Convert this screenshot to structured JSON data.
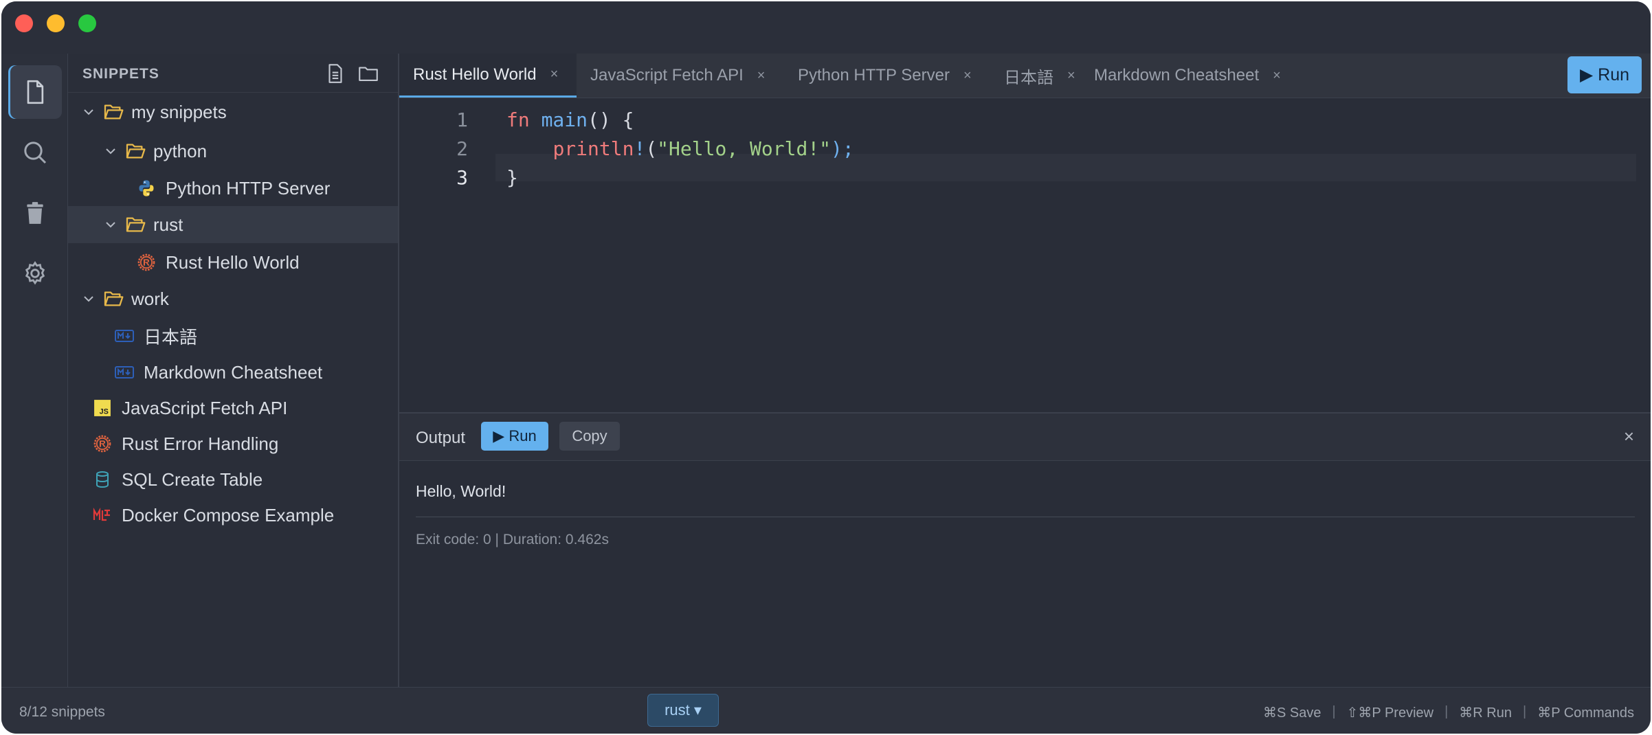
{
  "sidebar": {
    "title": "SNIPPETS",
    "tree": [
      {
        "label": "my snippets",
        "type": "folder",
        "depth": 0,
        "expanded": true
      },
      {
        "label": "python",
        "type": "folder",
        "depth": 1,
        "expanded": true
      },
      {
        "label": "Python HTTP Server",
        "type": "file",
        "depth": 2,
        "icon": "python-icon"
      },
      {
        "label": "rust",
        "type": "folder",
        "depth": 1,
        "expanded": true,
        "selected": true
      },
      {
        "label": "Rust Hello World",
        "type": "file",
        "depth": 2,
        "icon": "rust-icon"
      },
      {
        "label": "work",
        "type": "folder",
        "depth": 0,
        "expanded": true
      },
      {
        "label": "日本語",
        "type": "file",
        "depth": 1,
        "icon": "markdown-icon"
      },
      {
        "label": "Markdown Cheatsheet",
        "type": "file",
        "depth": 1,
        "icon": "markdown-icon"
      },
      {
        "label": "JavaScript Fetch API",
        "type": "file",
        "depth": 0,
        "icon": "javascript-icon"
      },
      {
        "label": "Rust Error Handling",
        "type": "file",
        "depth": 0,
        "icon": "rust-icon"
      },
      {
        "label": "SQL Create Table",
        "type": "file",
        "depth": 0,
        "icon": "database-icon"
      },
      {
        "label": "Docker Compose Example",
        "type": "file",
        "depth": 0,
        "icon": "docker-compose-icon"
      }
    ]
  },
  "tabs": [
    {
      "label": "Rust Hello World",
      "active": true
    },
    {
      "label": "JavaScript Fetch API",
      "active": false
    },
    {
      "label": "Python HTTP Server",
      "active": false
    },
    {
      "label": "日本語",
      "active": false
    },
    {
      "label": "Markdown Cheatsheet",
      "active": false
    }
  ],
  "tab_close_glyph": "×",
  "run_button": "▶ Run",
  "code": {
    "line_numbers": [
      "1",
      "2",
      "3"
    ],
    "line1": {
      "kw": "fn",
      "fn": "main",
      "rest": "() {"
    },
    "line2": {
      "indent": "    ",
      "macro": "println",
      "bang": "!",
      "open": "(",
      "str": "\"Hello, World!\"",
      "close": ");"
    },
    "line3": {
      "text": "}"
    }
  },
  "output": {
    "label": "Output",
    "run_label": "▶ Run",
    "copy_label": "Copy",
    "close_glyph": "×",
    "text": "Hello, World!",
    "meta": "Exit code: 0 | Duration: 0.462s"
  },
  "status": {
    "count": "8/12 snippets",
    "language": "rust ▾",
    "shortcuts": [
      "⌘S Save",
      "⇧⌘P Preview",
      "⌘R Run",
      "⌘P Commands"
    ],
    "separator": "|"
  },
  "colors": {
    "accent": "#64b1ee",
    "folder": "#e8b94a",
    "rust": "#e0633f",
    "python_blue": "#3d78b3",
    "python_yellow": "#f4d24b",
    "markdown": "#2d5fb8",
    "javascript": "#f0db4f",
    "database": "#3fa3b7"
  }
}
